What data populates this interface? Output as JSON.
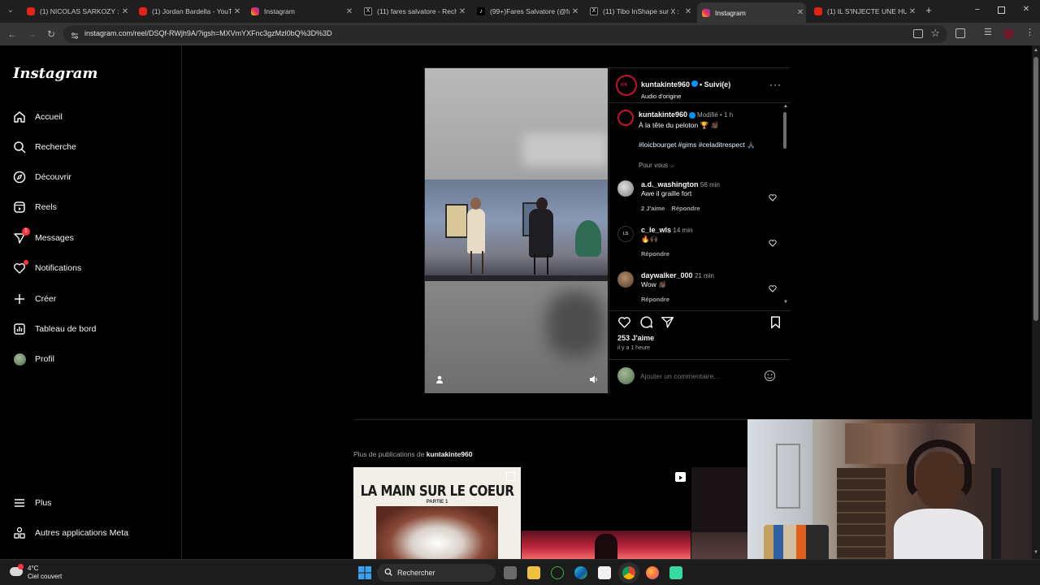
{
  "browser": {
    "tabs": [
      {
        "title": "(1) NICOLAS SARKOZY : l",
        "icon": "youtube-icon"
      },
      {
        "title": "(1) Jordan Bardella - YouT",
        "icon": "youtube-icon"
      },
      {
        "title": "Instagram",
        "icon": "instagram-icon"
      },
      {
        "title": "(11) fares salvatore - Rech",
        "icon": "x-icon"
      },
      {
        "title": "(99+)Fares Salvatore (@fa",
        "icon": "tiktok-icon"
      },
      {
        "title": "(11) Tibo InShape sur X :",
        "icon": "x-icon"
      },
      {
        "title": "Instagram",
        "icon": "instagram-icon",
        "active": true
      },
      {
        "title": "(1) IL S'INJECTE UNE HUI",
        "icon": "youtube-icon"
      }
    ],
    "url": "instagram.com/reel/DSQf-RWjh9A/?igsh=MXVmYXFnc3gzMzl0bQ%3D%3D"
  },
  "sidebar": {
    "logo": "Instagram",
    "items": [
      {
        "label": "Accueil",
        "icon": "home-icon"
      },
      {
        "label": "Recherche",
        "icon": "search-icon"
      },
      {
        "label": "Découvrir",
        "icon": "compass-icon"
      },
      {
        "label": "Reels",
        "icon": "reels-icon"
      },
      {
        "label": "Messages",
        "icon": "messenger-icon",
        "badge": "1"
      },
      {
        "label": "Notifications",
        "icon": "heart-icon"
      },
      {
        "label": "Créer",
        "icon": "plus-icon"
      },
      {
        "label": "Tableau de bord",
        "icon": "dashboard-icon"
      },
      {
        "label": "Profil",
        "icon": "avatar"
      }
    ],
    "bottom": [
      {
        "label": "Plus",
        "icon": "menu-icon"
      },
      {
        "label": "Autres applications Meta",
        "icon": "meta-apps-icon"
      }
    ]
  },
  "post": {
    "author": "kuntakinte960",
    "follow_status": "• Suivi(e)",
    "audio": "Audio d'origine",
    "caption": {
      "user": "kuntakinte960",
      "meta": "Modifié • 1 h",
      "text": "À la tête du peloton 🏆 👏🏿",
      "hashtags": "#loicbourget #gims #celaditrespect 🙏🏿",
      "for_you": "Pour vous ⌵"
    },
    "comments": [
      {
        "user": "a.d._washington",
        "time": "56 min",
        "text": "Awe il graille fort",
        "likes": "2 J'aime",
        "reply": "Répondre"
      },
      {
        "user": "c_le_wls",
        "time": "14 min",
        "text": "🔥🙌🏿",
        "likes": "",
        "reply": "Répondre"
      },
      {
        "user": "daywalker_000",
        "time": "21 min",
        "text": "Wow 👏🏿",
        "likes": "",
        "reply": "Répondre"
      }
    ],
    "likes": "253 J'aime",
    "posted": "il y a 1 heure",
    "comment_placeholder": "Ajouter un commentaire..."
  },
  "more_posts": {
    "prefix": "Plus de publications de ",
    "user": "kuntakinte960",
    "thumb1_title": "LA MAIN SUR LE COEUR",
    "thumb1_sub": "PARTIE 1"
  },
  "taskbar": {
    "weather_temp": "4°C",
    "weather_desc": "Ciel couvert",
    "search_label": "Rechercher"
  },
  "colors": {
    "accent": "#0095f6",
    "notification": "#ff3040",
    "background": "#000000"
  }
}
